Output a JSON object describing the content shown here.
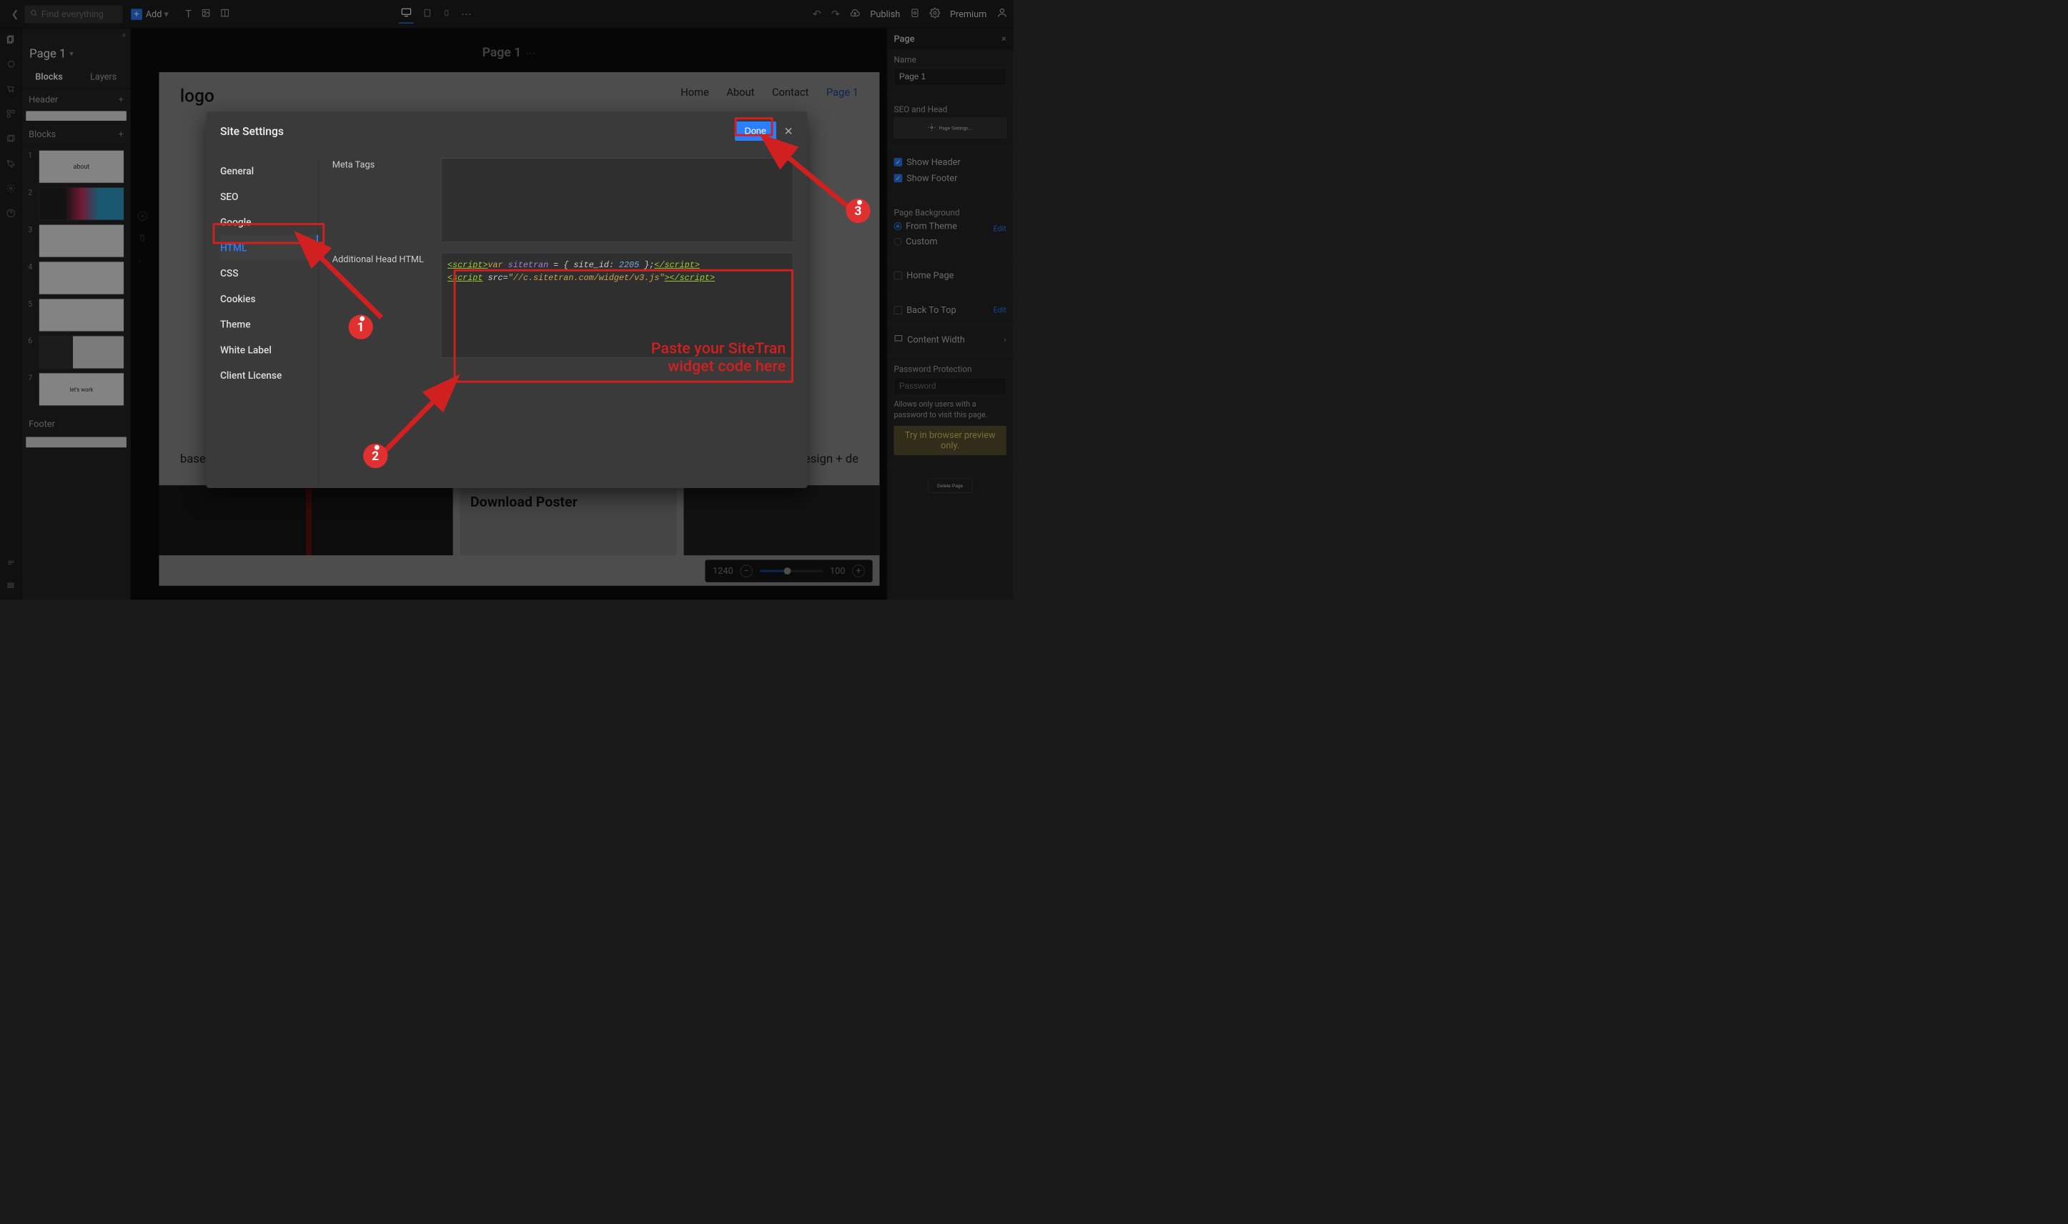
{
  "topbar": {
    "search_placeholder": "Find everything",
    "add_label": "Add",
    "publish_label": "Publish",
    "premium_label": "Premium"
  },
  "leftpanel": {
    "page_dropdown": "Page 1",
    "tabs": {
      "blocks": "Blocks",
      "layers": "Layers"
    },
    "section_header": "Header",
    "section_blocks": "Blocks",
    "section_footer": "Footer",
    "thumbs": [
      {
        "n": "1",
        "label": "about"
      },
      {
        "n": "2",
        "label": ""
      },
      {
        "n": "3",
        "label": ""
      },
      {
        "n": "4",
        "label": ""
      },
      {
        "n": "5",
        "label": ""
      },
      {
        "n": "6",
        "label": ""
      },
      {
        "n": "7",
        "label": "let's work"
      }
    ]
  },
  "canvas": {
    "page_title": "Page 1",
    "sheet": {
      "logo": "logo",
      "nav": {
        "home": "Home",
        "about": "About",
        "contact": "Contact",
        "page1": "Page 1"
      },
      "strap_left": "based in new york",
      "strap_right": "digital design + de",
      "poster_text": "Download Poster"
    },
    "zoom": {
      "cur": "1240",
      "pct": "100"
    }
  },
  "modal": {
    "title": "Site Settings",
    "done": "Done",
    "menu": {
      "general": "General",
      "seo": "SEO",
      "google": "Google",
      "html": "HTML",
      "css": "CSS",
      "cookies": "Cookies",
      "theme": "Theme",
      "whitelabel": "White Label",
      "license": "Client License"
    },
    "fields": {
      "meta_tags": "Meta Tags",
      "additional_head": "Additional Head HTML"
    },
    "code": {
      "line1_open": "<script>",
      "line1_var": "var",
      "line1_ident": " sitetran ",
      "line1_eq": "= { site_id: ",
      "line1_num": "2205",
      "line1_close": " };",
      "line1_end": "</script>",
      "line2_open": "<script",
      "line2_src": " src=",
      "line2_url": "\"//c.sitetran.com/widget/v3.js\"",
      "line2_gt": ">",
      "line2_end": "</script>"
    }
  },
  "annotations": {
    "paste_text": "Paste your SiteTran\nwidget code here",
    "m1": "1",
    "m2": "2",
    "m3": "3"
  },
  "rightpanel": {
    "section_page": "Page",
    "name_label": "Name",
    "name_value": "Page 1",
    "seo_head": "SEO and Head",
    "page_settings_btn": "Page Settings...",
    "show_header": "Show Header",
    "show_footer": "Show Footer",
    "bg_label": "Page Background",
    "from_theme": "From Theme",
    "custom": "Custom",
    "edit": "Edit",
    "home_page": "Home Page",
    "back_to_top": "Back To Top",
    "content_width": "Content Width",
    "pw_protect": "Password Protection",
    "pw_placeholder": "Password",
    "pw_help": "Allows only users with a password to visit this page.",
    "try_preview": "Try in browser preview only.",
    "delete_page": "Delete Page"
  }
}
